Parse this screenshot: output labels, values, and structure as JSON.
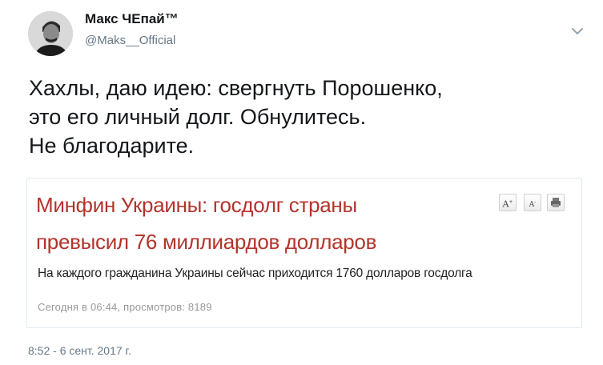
{
  "author": {
    "name": "Макс ЧЕпай™",
    "handle": "@Maks__Official"
  },
  "tweet": {
    "lines": [
      "Хахлы, даю идею: свергнуть Порошенко,",
      "это его личный долг. Обнулитесь.",
      "Не благодарите."
    ],
    "timestamp": "8:52 - 6 сент. 2017 г."
  },
  "article": {
    "headline_lines": [
      "Минфин Украины: госдолг страны",
      "превысил 76 миллиардов долларов"
    ],
    "subtitle": "На каждого гражданина Украины сейчас приходится 1760 долларов госдолга",
    "meta": "Сегодня в 06:44, просмотров: 8189",
    "tools": {
      "increase_font": "A",
      "decrease_font": "A",
      "print_icon": "print-icon"
    }
  },
  "icons": {
    "menu": "chevron-down-icon"
  },
  "colors": {
    "headline": "#b2342b",
    "secondary_text": "#657786",
    "meta_text": "#999999"
  }
}
